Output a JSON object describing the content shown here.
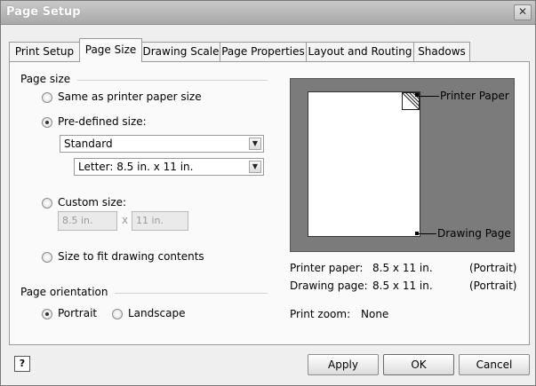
{
  "window": {
    "title": "Page Setup",
    "close_icon": "close-x-icon"
  },
  "tabs": [
    {
      "label": "Print Setup",
      "active": false
    },
    {
      "label": "Page Size",
      "active": true
    },
    {
      "label": "Drawing Scale",
      "active": false
    },
    {
      "label": "Page Properties",
      "active": false
    },
    {
      "label": "Layout and Routing",
      "active": false
    },
    {
      "label": "Shadows",
      "active": false
    }
  ],
  "page_size": {
    "group_label": "Page size",
    "options": {
      "same_as_printer": {
        "label": "Same as printer paper size",
        "checked": false
      },
      "predefined": {
        "label": "Pre-defined size:",
        "checked": true
      },
      "custom": {
        "label": "Custom size:",
        "checked": false
      },
      "fit_drawing": {
        "label": "Size to fit drawing contents",
        "checked": false
      }
    },
    "predefined_category": "Standard",
    "predefined_size": "Letter:  8.5 in. x 11 in.",
    "custom_width": "8.5 in.",
    "custom_height": "11 in.",
    "custom_separator": "x"
  },
  "orientation": {
    "group_label": "Page orientation",
    "portrait": {
      "label": "Portrait",
      "checked": true
    },
    "landscape": {
      "label": "Landscape",
      "checked": false
    }
  },
  "preview": {
    "printer_paper_label": "Printer Paper",
    "drawing_page_label": "Drawing Page"
  },
  "info": {
    "printer_paper_key": "Printer paper:",
    "printer_paper_value": "8.5 x 11 in.",
    "printer_paper_orientation": "(Portrait)",
    "drawing_page_key": "Drawing page:",
    "drawing_page_value": "8.5 x 11 in.",
    "drawing_page_orientation": "(Portrait)",
    "print_zoom_key": "Print zoom:",
    "print_zoom_value": "None"
  },
  "buttons": {
    "apply": "Apply",
    "ok": "OK",
    "cancel": "Cancel",
    "help_icon": "help-question-icon",
    "help_glyph": "?"
  },
  "colors": {
    "preview_background": "#7b7b7b",
    "titlebar": "#b5b5b5"
  }
}
